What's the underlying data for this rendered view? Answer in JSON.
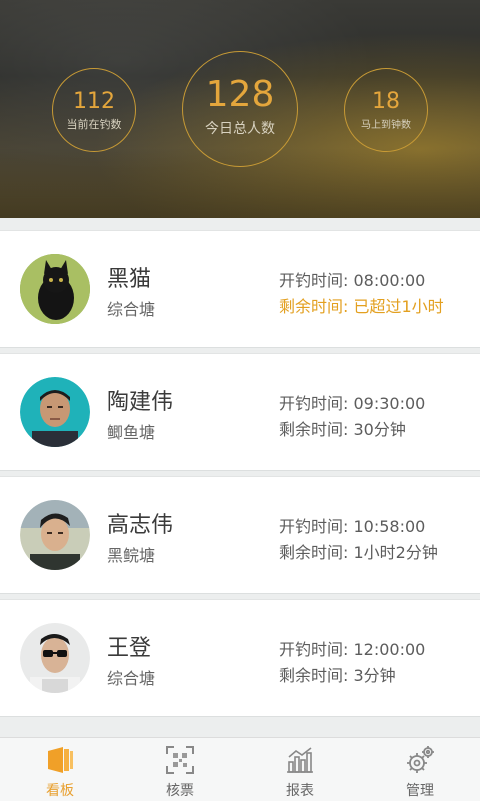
{
  "stats": {
    "current_fishing": {
      "value": "112",
      "label": "当前在钓数"
    },
    "today_total": {
      "value": "128",
      "label": "今日总人数"
    },
    "due_soon": {
      "value": "18",
      "label": "马上到钟数"
    }
  },
  "cards": [
    {
      "name": "黑猫",
      "pond": "综合塘",
      "start_label": "开钓时间:",
      "start": "08:00:00",
      "remain_label": "剩余时间:",
      "remain": "已超过1小时",
      "overdue": true
    },
    {
      "name": "陶建伟",
      "pond": "鲫鱼塘",
      "start_label": "开钓时间:",
      "start": "09:30:00",
      "remain_label": "剩余时间:",
      "remain": "30分钟",
      "overdue": false
    },
    {
      "name": "高志伟",
      "pond": "黑鲩塘",
      "start_label": "开钓时间:",
      "start": "10:58:00",
      "remain_label": "剩余时间:",
      "remain": "1小时2分钟",
      "overdue": false
    },
    {
      "name": "王登",
      "pond": "综合塘",
      "start_label": "开钓时间:",
      "start": "12:00:00",
      "remain_label": "剩余时间:",
      "remain": "3分钟",
      "overdue": false
    }
  ],
  "tabs": [
    {
      "label": "看板",
      "icon": "dashboard-icon",
      "active": true
    },
    {
      "label": "核票",
      "icon": "qr-scan-icon",
      "active": false
    },
    {
      "label": "报表",
      "icon": "bar-chart-icon",
      "active": false
    },
    {
      "label": "管理",
      "icon": "gears-icon",
      "active": false
    }
  ],
  "colors": {
    "accent": "#e8a030",
    "warning": "#e3a020",
    "ring": "#c79a35"
  }
}
